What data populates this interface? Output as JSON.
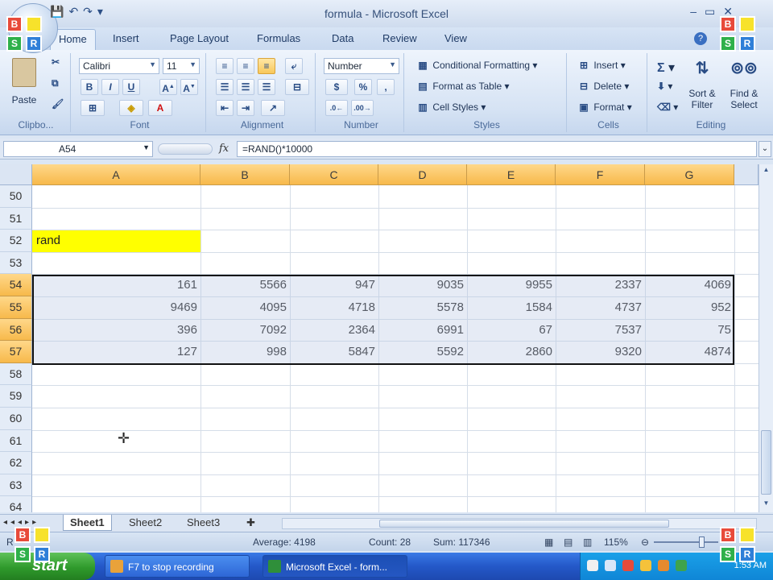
{
  "window": {
    "title": "formula - Microsoft Excel",
    "qat": [
      "💾",
      "↶",
      "↷",
      "▾"
    ],
    "controls": [
      "–",
      "▭",
      "✕"
    ]
  },
  "ribbon_tabs": [
    "Home",
    "Insert",
    "Page Layout",
    "Formulas",
    "Data",
    "Review",
    "View"
  ],
  "ribbon": {
    "clipboard": {
      "label": "Clipbo...",
      "paste": "Paste"
    },
    "font": {
      "label": "Font",
      "name": "Calibri",
      "size": "11",
      "bold": "B",
      "italic": "I",
      "underline": "U"
    },
    "alignment": {
      "label": "Alignment"
    },
    "number": {
      "label": "Number",
      "format": "Number",
      "currency": "$",
      "percent": "%",
      "comma": ","
    },
    "styles": {
      "label": "Styles",
      "conditional": "Conditional Formatting",
      "table": "Format as Table",
      "cell_styles": "Cell Styles"
    },
    "cells": {
      "label": "Cells",
      "insert": "Insert",
      "delete": "Delete",
      "format": "Format"
    },
    "editing": {
      "label": "Editing",
      "sort": "Sort &",
      "sort2": "Filter",
      "find": "Find &",
      "find2": "Select"
    }
  },
  "formula_bar": {
    "name_box": "A54",
    "fx": "fx",
    "formula": "=RAND()*10000"
  },
  "grid": {
    "columns": [
      "A",
      "B",
      "C",
      "D",
      "E",
      "F",
      "G"
    ],
    "rows": [
      "50",
      "51",
      "52",
      "53",
      "54",
      "55",
      "56",
      "57",
      "58",
      "59",
      "60",
      "61",
      "62",
      "63",
      "64"
    ],
    "label_cell": "rand",
    "data": [
      [
        "161",
        "5566",
        "947",
        "9035",
        "9955",
        "2337",
        "4069"
      ],
      [
        "9469",
        "4095",
        "4718",
        "5578",
        "1584",
        "4737",
        "952"
      ],
      [
        "396",
        "7092",
        "2364",
        "6991",
        "67",
        "7537",
        "75"
      ],
      [
        "127",
        "998",
        "5847",
        "5592",
        "2860",
        "9320",
        "4874"
      ]
    ]
  },
  "sheets": [
    "Sheet1",
    "Sheet2",
    "Sheet3"
  ],
  "status": {
    "mode": "R",
    "average": "Average: 4198",
    "count": "Count: 28",
    "sum": "Sum: 117346",
    "zoom": "115%"
  },
  "taskbar": {
    "start": "start",
    "tasks": [
      "F7 to stop recording",
      "Microsoft Excel - form..."
    ],
    "clock": "1:53 AM"
  },
  "colors": {
    "header_selected": "#f7b94b",
    "yellow_fill": "#ffff00",
    "taskbar": "#2458c8"
  }
}
